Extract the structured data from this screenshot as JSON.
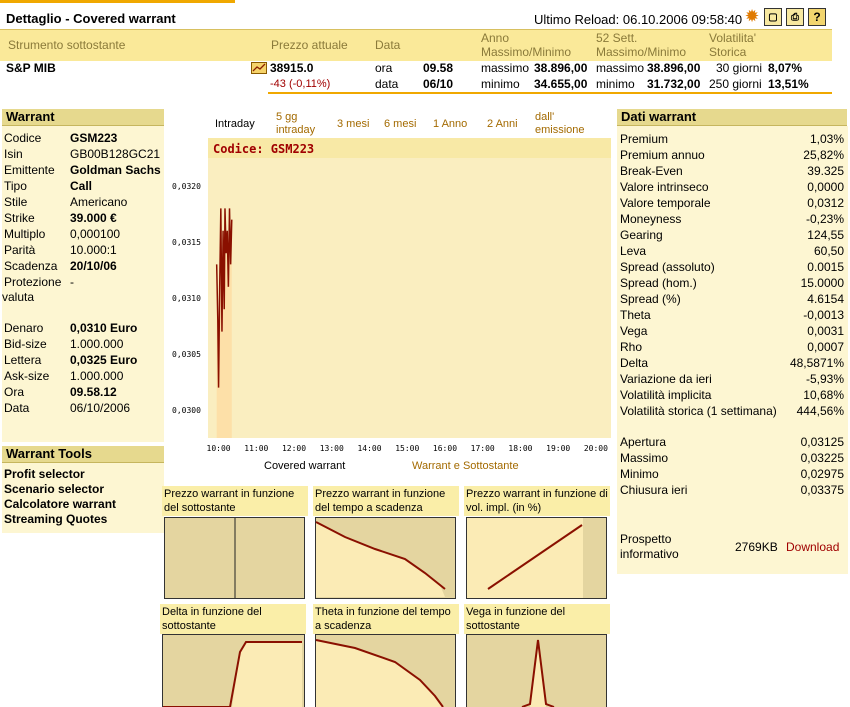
{
  "header": {
    "title": "Dettaglio - Covered warrant",
    "reload": "Ultimo Reload: 06.10.2006 09:58:40",
    "icons": [
      "sun-icon",
      "new-window-icon",
      "print-icon",
      "help-icon"
    ],
    "help_glyph": "?"
  },
  "columns": {
    "underlying": "Strumento sottostante",
    "price": "Prezzo attuale",
    "date": "Data",
    "year": [
      "Anno",
      "Massimo/Minimo"
    ],
    "weeks": [
      "52 Sett.",
      "Massimo/Minimo"
    ],
    "vol": [
      "Volatilita'",
      "Storica"
    ]
  },
  "quote": {
    "name": "S&P MIB",
    "price": "38915.0",
    "change": "-43 (-0,11%)",
    "ora_label": "ora",
    "ora": "09.58",
    "data_label": "data",
    "data": "06/10",
    "year_max_label": "massimo",
    "year_max": "38.896,00",
    "year_min_label": "minimo",
    "year_min": "34.655,00",
    "w_max_label": "massimo",
    "w_max": "38.896,00",
    "w_min_label": "minimo",
    "w_min": "31.732,00",
    "vol30_label": "30 giorni",
    "vol30": "8,07%",
    "vol250_label": "250 giorni",
    "vol250": "13,51%"
  },
  "warrant": {
    "title": "Warrant",
    "rows": [
      {
        "k": "Codice",
        "v": "GSM223",
        "bold": true
      },
      {
        "k": "Isin",
        "v": "GB00B128GC21",
        "bold": false
      },
      {
        "k": "Emittente",
        "v": "Goldman Sachs",
        "bold": true
      },
      {
        "k": "Tipo",
        "v": "Call",
        "bold": true
      },
      {
        "k": "Stile",
        "v": "Americano",
        "bold": false
      },
      {
        "k": "Strike",
        "v": "39.000 €",
        "bold": true
      },
      {
        "k": "Multiplo",
        "v": "0,000100",
        "bold": false
      },
      {
        "k": "Parità",
        "v": "10.000:1",
        "bold": false
      },
      {
        "k": "Scadenza",
        "v": "20/10/06",
        "bold": true
      },
      {
        "k": "Protezione",
        "v": "-",
        "bold": false
      }
    ],
    "protezione_2": "valuta",
    "rows2": [
      {
        "k": "Denaro",
        "v": "0,0310 Euro",
        "bold": true
      },
      {
        "k": "Bid-size",
        "v": "1.000.000",
        "bold": false
      },
      {
        "k": "Lettera",
        "v": "0,0325 Euro",
        "bold": true
      },
      {
        "k": "Ask-size",
        "v": "1.000.000",
        "bold": false
      },
      {
        "k": "Ora",
        "v": "09.58.12",
        "bold": true
      },
      {
        "k": "Data",
        "v": "06/10/2006",
        "bold": false
      }
    ]
  },
  "tools": {
    "title": "Warrant Tools",
    "items": [
      "Profit selector",
      "Scenario selector",
      "Calcolatore warrant",
      "Streaming Quotes"
    ]
  },
  "chart_tabs": [
    "Intraday",
    "5 gg intraday",
    "3 mesi",
    "6 mesi",
    "1 Anno",
    "2 Anni",
    "dall' emissione"
  ],
  "chart_code": "Codice: GSM223",
  "chart_links": {
    "left": "Covered warrant",
    "right": "Warrant e Sottostante"
  },
  "chart_data": {
    "type": "line",
    "yticks": [
      "0,0320",
      "0,0315",
      "0,0310",
      "0,0305",
      "0,0300"
    ],
    "ytick_values": [
      0.032,
      0.0315,
      0.031,
      0.0305,
      0.03
    ],
    "ylim": [
      0.02975,
      0.03225
    ],
    "xticks": [
      "10:00",
      "11:00",
      "12:00",
      "13:00",
      "14:00",
      "15:00",
      "16:00",
      "17:00",
      "18:00",
      "19:00",
      "20:00"
    ],
    "xlim": [
      9.72,
      20.4
    ],
    "x": [
      9.95,
      9.98,
      10.0,
      10.03,
      10.06,
      10.09,
      10.12,
      10.15,
      10.17,
      10.2,
      10.23,
      10.26,
      10.29,
      10.32,
      10.35
    ],
    "y": [
      0.0313,
      0.0308,
      0.0302,
      0.0311,
      0.0318,
      0.0307,
      0.0316,
      0.0309,
      0.0318,
      0.0314,
      0.0316,
      0.0311,
      0.0318,
      0.0313,
      0.0317
    ]
  },
  "mini_titles": [
    "Prezzo warrant in funzione del sottostante",
    "Prezzo warrant in funzione del tempo a scadenza",
    "Prezzo warrant in funzione di vol. impl. (in %)",
    "Delta in funzione del sottostante",
    "Theta in funzione del tempo a scadenza",
    "Vega in funzione del sottostante"
  ],
  "dati": {
    "title": "Dati warrant",
    "rows": [
      {
        "k": "Premium",
        "v": "1,03%"
      },
      {
        "k": "Premium annuo",
        "v": "25,82%"
      },
      {
        "k": "Break-Even",
        "v": "39.325"
      },
      {
        "k": "Valore intrinseco",
        "v": "0,0000"
      },
      {
        "k": "Valore temporale",
        "v": "0,0312"
      },
      {
        "k": "Moneyness",
        "v": "-0,23%"
      },
      {
        "k": "Gearing",
        "v": "124,55"
      },
      {
        "k": "Leva",
        "v": "60,50"
      },
      {
        "k": "Spread (assoluto)",
        "v": "0.0015"
      },
      {
        "k": "Spread (hom.)",
        "v": "15.0000"
      },
      {
        "k": "Spread (%)",
        "v": "4.6154"
      },
      {
        "k": "Theta",
        "v": "-0,0013"
      },
      {
        "k": "Vega",
        "v": "0,0031"
      },
      {
        "k": "Rho",
        "v": "0,0007"
      },
      {
        "k": "Delta",
        "v": "48,5871%"
      },
      {
        "k": "Variazione da ieri",
        "v": "-5,93%"
      },
      {
        "k": "Volatilità implicita",
        "v": "10,68%"
      },
      {
        "k": "Volatilità storica (1 settimana)",
        "v": "444,56%"
      }
    ],
    "rows2": [
      {
        "k": "Apertura",
        "v": "0,03125"
      },
      {
        "k": "Massimo",
        "v": "0,03225"
      },
      {
        "k": "Minimo",
        "v": "0,02975"
      },
      {
        "k": "Chiusura ieri",
        "v": "0,03375"
      }
    ],
    "prospetto": [
      "Prospetto",
      "informativo"
    ],
    "size": "2769KB",
    "download": "Download"
  }
}
